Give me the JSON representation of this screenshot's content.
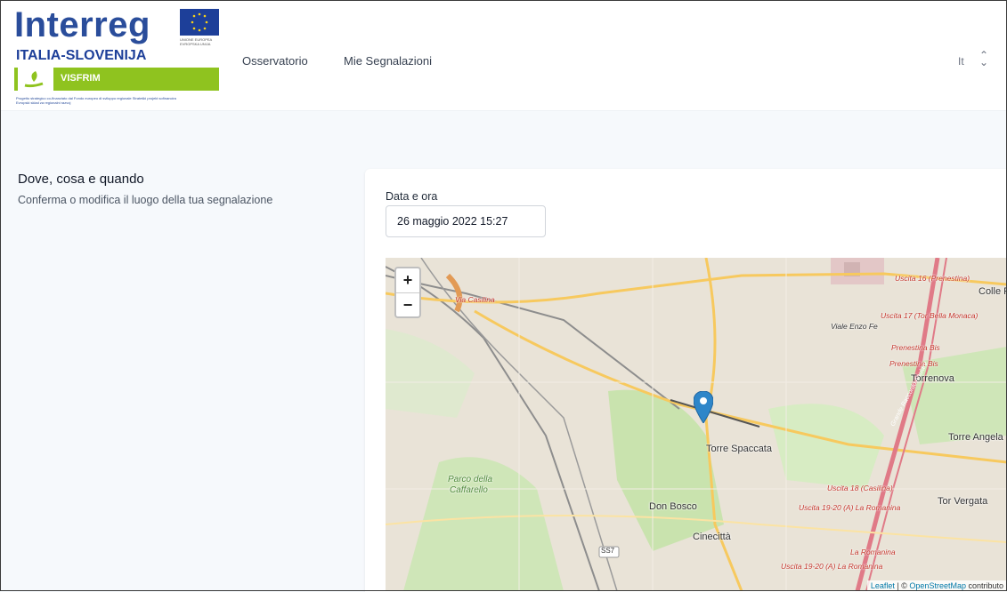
{
  "brand": {
    "wordmark": "Interreg",
    "program": "ITALIA-SLOVENIJA",
    "project": "VISFRIM",
    "eu_caption": "UNIONE EUROPEA EVROPSKA UNIJA",
    "caption": "Progetto strategico co-finanziato dal Fondo europeo di sviluppo regionale Strateški projekt sofinancira Evropski sklad za regionalni razvoj"
  },
  "nav": {
    "items": [
      "Osservatorio",
      "Mie Segnalazioni"
    ],
    "language": "It"
  },
  "section": {
    "title": "Dove, cosa e quando",
    "subtitle": "Conferma o modifica il luogo della tua segnalazione"
  },
  "form": {
    "date_label": "Data e ora",
    "date_value": "26 maggio 2022 15:27"
  },
  "map": {
    "zoom_in": "+",
    "zoom_out": "−",
    "labels": {
      "torre_spaccata": "Torre Spaccata",
      "don_bosco": "Don Bosco",
      "cinecitta": "Cinecittà",
      "torrenova": "Torrenova",
      "torre_angela": "Torre Angela",
      "tor_vergata": "Tor Vergata",
      "colle": "Colle F",
      "parco1": "Parco della",
      "parco2": "Caffarello",
      "via_casilina": "Via Casilina",
      "viale_enzo": "Viale Enzo Fe",
      "uscita16": "Uscita 16 (Prenestina)",
      "uscita17": "Uscita 17 (Tor Bella Monaca)",
      "prenestina_bis1": "Prenestina Bis",
      "prenestina_bis2": "Prenestina Bis",
      "uscita18": "Uscita 18 (Casilina)",
      "uscita1920a": "Uscita 19-20 (A) La Romanina",
      "la_romanina": "La Romanina",
      "uscita1920b": "Uscita 19-20 (A) La Romanina",
      "ss7": "SS7",
      "grande_raccordo": "Grande Raccordo Anulare"
    },
    "attribution_leaflet": "Leaflet",
    "attribution_rest": " | © ",
    "attribution_osm": "OpenStreetMap",
    "attribution_contrib": " contributo"
  }
}
